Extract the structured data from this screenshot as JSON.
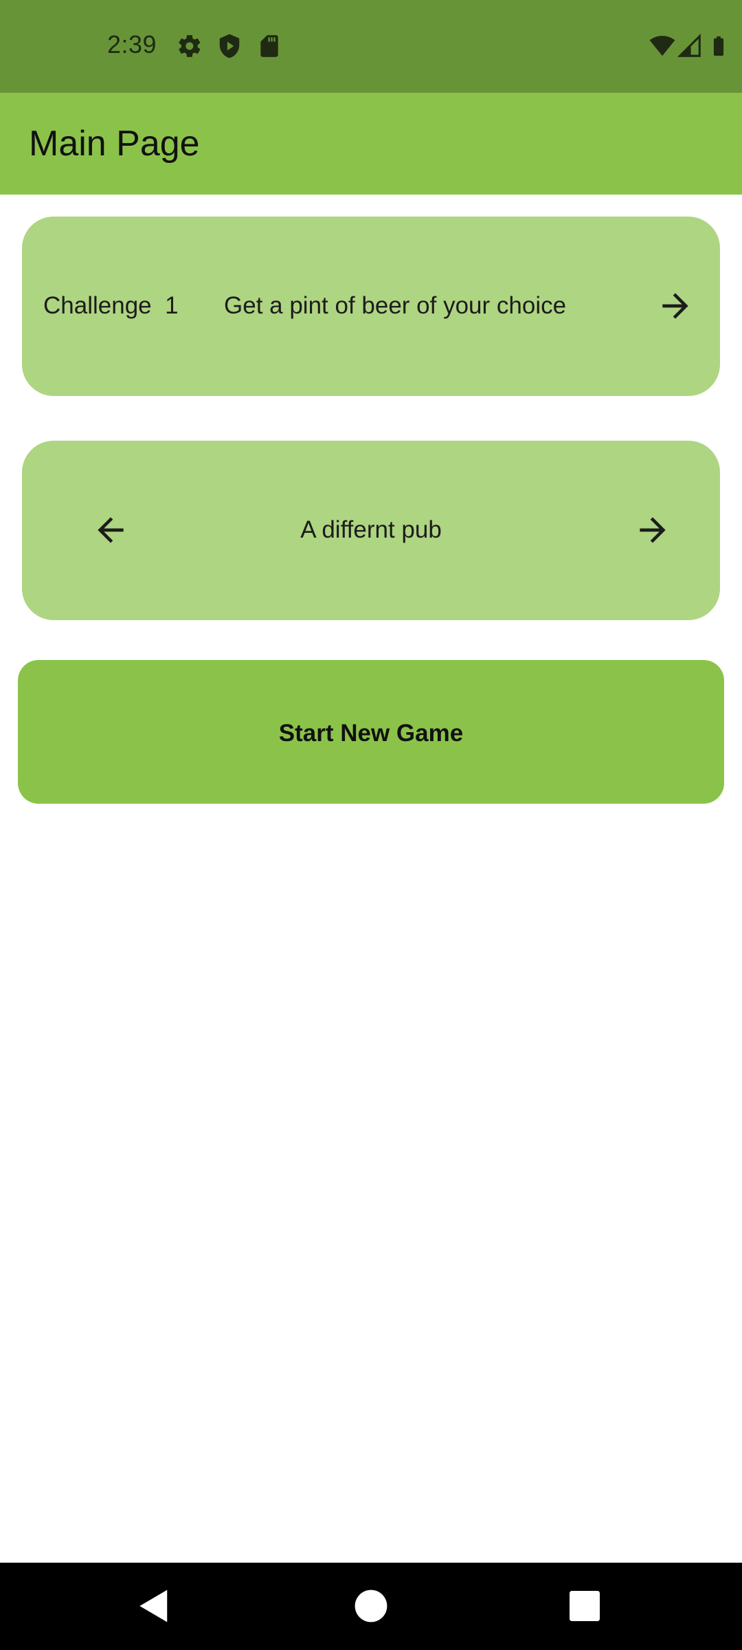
{
  "status_bar": {
    "time": "2:39",
    "left_icons": [
      "gear-icon",
      "shield-play-icon",
      "sd-card-icon"
    ],
    "right_icons": [
      "wifi-icon",
      "cell-signal-icon",
      "battery-icon"
    ]
  },
  "app_bar": {
    "title": "Main Page"
  },
  "challenge_card": {
    "label": "Challenge  1",
    "description": "Get a pint of beer of your choice",
    "next_icon": "arrow-right-icon"
  },
  "pub_card": {
    "prev_icon": "arrow-left-icon",
    "label": "A differnt pub",
    "next_icon": "arrow-right-icon"
  },
  "start_button": {
    "label": "Start New Game"
  },
  "nav_bar": {
    "buttons": [
      "back-icon",
      "home-icon",
      "recents-icon"
    ]
  },
  "colors": {
    "status_bar": "#689438",
    "app_bar": "#8bc34a",
    "card": "#aed581",
    "button": "#8bc34a",
    "nav_bar": "#000000"
  }
}
